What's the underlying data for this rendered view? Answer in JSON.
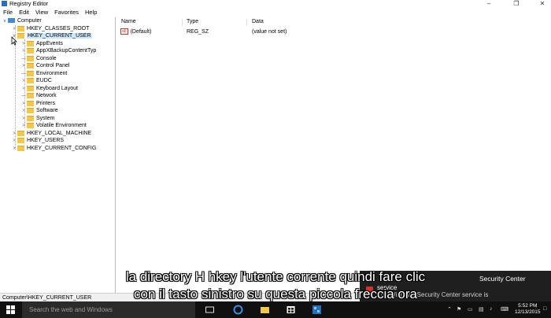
{
  "window": {
    "title": "Registry Editor",
    "minimize": "–",
    "maximize": "❐",
    "close": "✕"
  },
  "menu": [
    "File",
    "Edit",
    "View",
    "Favorites",
    "Help"
  ],
  "tree": {
    "root": "Computer",
    "hives": {
      "classes_root": "HKEY_CLASSES_ROOT",
      "current_user": "HKEY_CURRENT_USER",
      "local_machine": "HKEY_LOCAL_MACHINE",
      "users": "HKEY_USERS",
      "current_config": "HKEY_CURRENT_CONFIG"
    },
    "current_user_children": [
      "AppEvents",
      "AppXBackupContentTyp",
      "Console",
      "Control Panel",
      "Environment",
      "EUDC",
      "Keyboard Layout",
      "Network",
      "Printers",
      "Software",
      "System",
      "Volatile Environment"
    ]
  },
  "list": {
    "columns": {
      "name": "Name",
      "type": "Type",
      "data": "Data"
    },
    "rows": [
      {
        "name": "(Default)",
        "type": "REG_SZ",
        "data": "(value not set)",
        "icon": "ab"
      }
    ]
  },
  "status": {
    "path": "Computer\\HKEY_CURRENT_USER"
  },
  "taskbar": {
    "search_placeholder": "Search the web and Windows",
    "time": "5:52 PM",
    "date": "12/13/2015"
  },
  "toast": {
    "title": "Security Center",
    "line1": "service",
    "line2": "The Windows Security Center service is"
  },
  "subtitles": {
    "line1": "la directory H hkey l'utente corrente quindi fare clic",
    "line2": "con il tasto sinistro su questa piccola freccia ora"
  },
  "colors": {
    "selection": "#cce8ff",
    "folder": "#f3c84a",
    "taskbar": "#101010"
  }
}
